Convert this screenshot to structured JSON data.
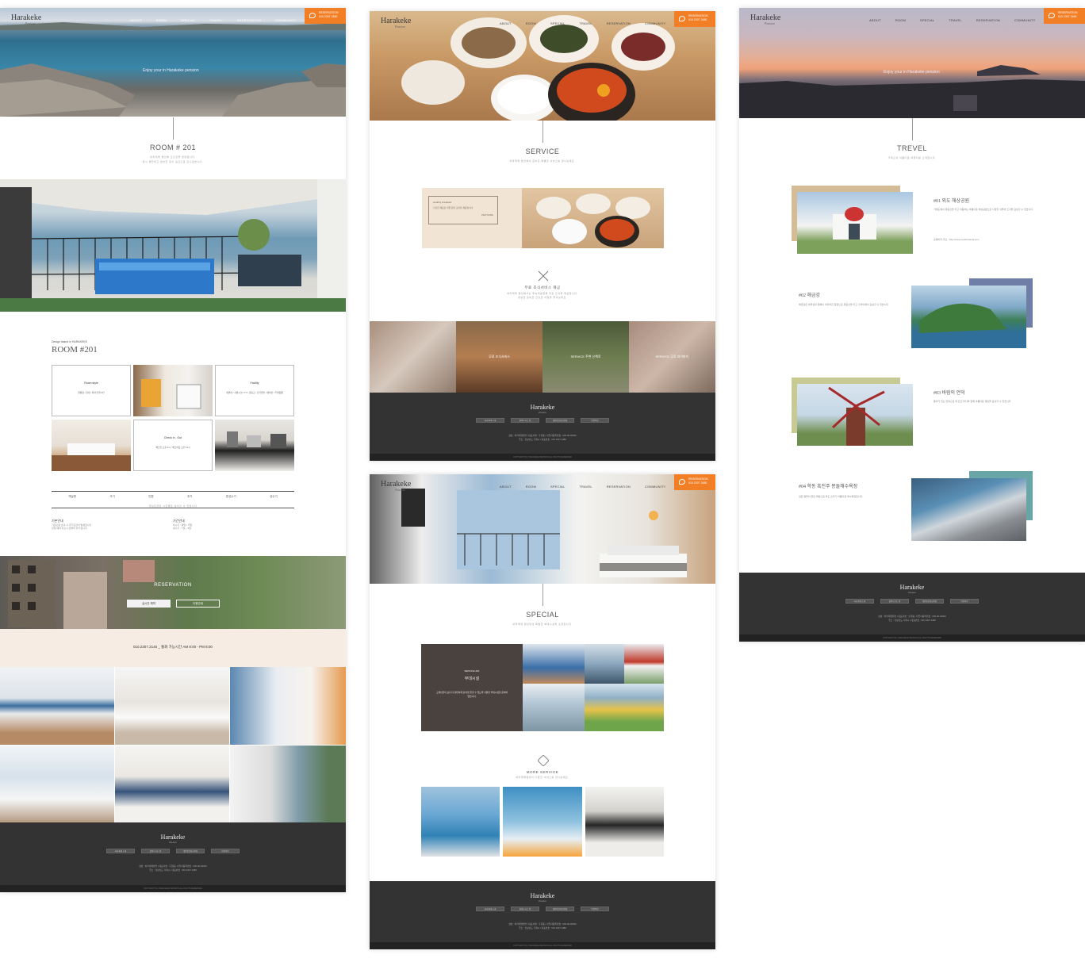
{
  "brand": {
    "logo": "Harakeke",
    "logo_sub": "Pension"
  },
  "nav": [
    "ABOUT",
    "ROOM",
    "SPECIAL",
    "TRAVEL",
    "RESERVATION",
    "COMMUNITY"
  ],
  "reservation_btn": {
    "label": "RESERVATION",
    "phone": "010 2307 2480"
  },
  "hero_caption": "Enjoy your in Harakeke pension",
  "colors": {
    "accent": "#f27f26",
    "footer": "#333333",
    "beige": "#f1e4d5",
    "dark_brown": "#4a423f"
  },
  "room_page": {
    "title": "ROOM # 201",
    "intro_lines": [
      "하라케케 펜션에 오신것을 환영합니다.",
      "항시 깨끗하고 편안한 휴식 공간으로 모시겠습니다."
    ],
    "eyebrow": "Design Island in HARAKEKE",
    "room_heading": "ROOM #201",
    "boxes": [
      {
        "title": "Room style",
        "text": "원룸형 / 침대 / 최대 인원 4인"
      },
      {
        "title": "Facility",
        "text": "세면대 / 샤워시설 / TV / 냉장고 / 전기밥솥 / 에어컨 / 주방용품"
      },
      {
        "title": "Check in . Out",
        "text": "체크인 오후 3시 / 체크아웃 오전 11시"
      }
    ],
    "table_headers": [
      "객실명",
      "크기",
      "인원",
      "추가",
      "준성수기",
      "성수기"
    ],
    "table_note": "객실요금은 시즌별로 상이할 수 있습니다",
    "notes_left_title": "기본안내",
    "notes_left": [
      "기준인원 초과 시 추가요금이 발생합니다",
      "당일 예약 취소시 환불이 불가합니다"
    ],
    "notes_right_title": "기간안내",
    "notes_right": [
      "비수기 : 평일 / 주말",
      "성수기 : 7월 ~ 8월"
    ],
    "reservation_title": "RESERVATION",
    "reservation_buttons": [
      "실시간 예약",
      "이용안내"
    ],
    "phone_line": "010.2307.2145 _ 통화 가능시간 AM 8:00 - PM 8:00"
  },
  "service_page": {
    "title": "SERVICE",
    "subtitle": "하라케케 펜션에서 준비한 특별한 서비스를 만나보세요.",
    "card_label": "Healthy breakfast",
    "card_text": "신선한 재료로 직접 만든 조식을 제공합니다.",
    "card_more": "VIEW MORE",
    "breakfast_title": "무료 조식서비스 제공",
    "breakfast_text": [
      "하라케케 펜션에서는 투숙객분들께 무료 조식을 제공합니다.",
      "정성껏 준비한 건강한 아침을 즐겨보세요."
    ],
    "strip_labels": [
      "",
      "무료 조식서비스",
      "SERVICE 주변 산책로",
      "SERVICE 무료 와이파이"
    ]
  },
  "special_page": {
    "title": "SPECIAL",
    "subtitle": "하라케케 펜션만의 특별한 부대시설을 소개합니다.",
    "card_eyebrow": "SERVICE #04",
    "card_title": "부대시설",
    "card_text": "고객님들이 보다 더 편안하게 휴식을 즐길 수 있도록 다양한 부대시설을 준비하였습니다.",
    "more_title": "MORE SERVICE",
    "more_sub": "하라케케펜션의 다양한 서비스를 만나보세요."
  },
  "travel_page": {
    "title": "TREVEL",
    "subtitle": "거제도의 아름다운 여행지를 소개합니다.",
    "items": [
      {
        "title": "#01 외도 해상공원",
        "text": "거제도에서 유람선을 타고 이동하는 아름다운 해상공원으로 다양한 식물과 조각을 감상할 수 있습니다.",
        "link": "홈페이지 주소 : http://www.oedobotania.com"
      },
      {
        "title": "#02 해금강",
        "text": "해금강은 바위섬과 절벽이 어우러진 절경으로 유람선을 타고 가까이에서 감상할 수 있습니다."
      },
      {
        "title": "#03 바람의 언덕",
        "text": "풍차가 있는 언덕으로 탁 트인 바다와 함께 아름다운 경관을 감상할 수 있습니다."
      },
      {
        "title": "#04 학동 흑진주 몽돌해수욕장",
        "text": "검은 몽돌이 깔린 해변으로 파도 소리가 아름다운 해수욕장입니다."
      }
    ]
  },
  "footer": {
    "buttons": [
      "하라케케 소개",
      "찾아오시는 길",
      "개인정보취급방침",
      "이용약관"
    ],
    "info1": "상호 : 하라케케펜션 | 대표자명 : 홍길동 | 사업자등록번호 : 000-00-00000",
    "info2": "주소 : 경상남도 거제시 | 대표번호 : 010 2307 2480",
    "copyright": "COPYRIGHT(C) HARAKEKE PENSION ALL RIGHTS RESERVED"
  }
}
